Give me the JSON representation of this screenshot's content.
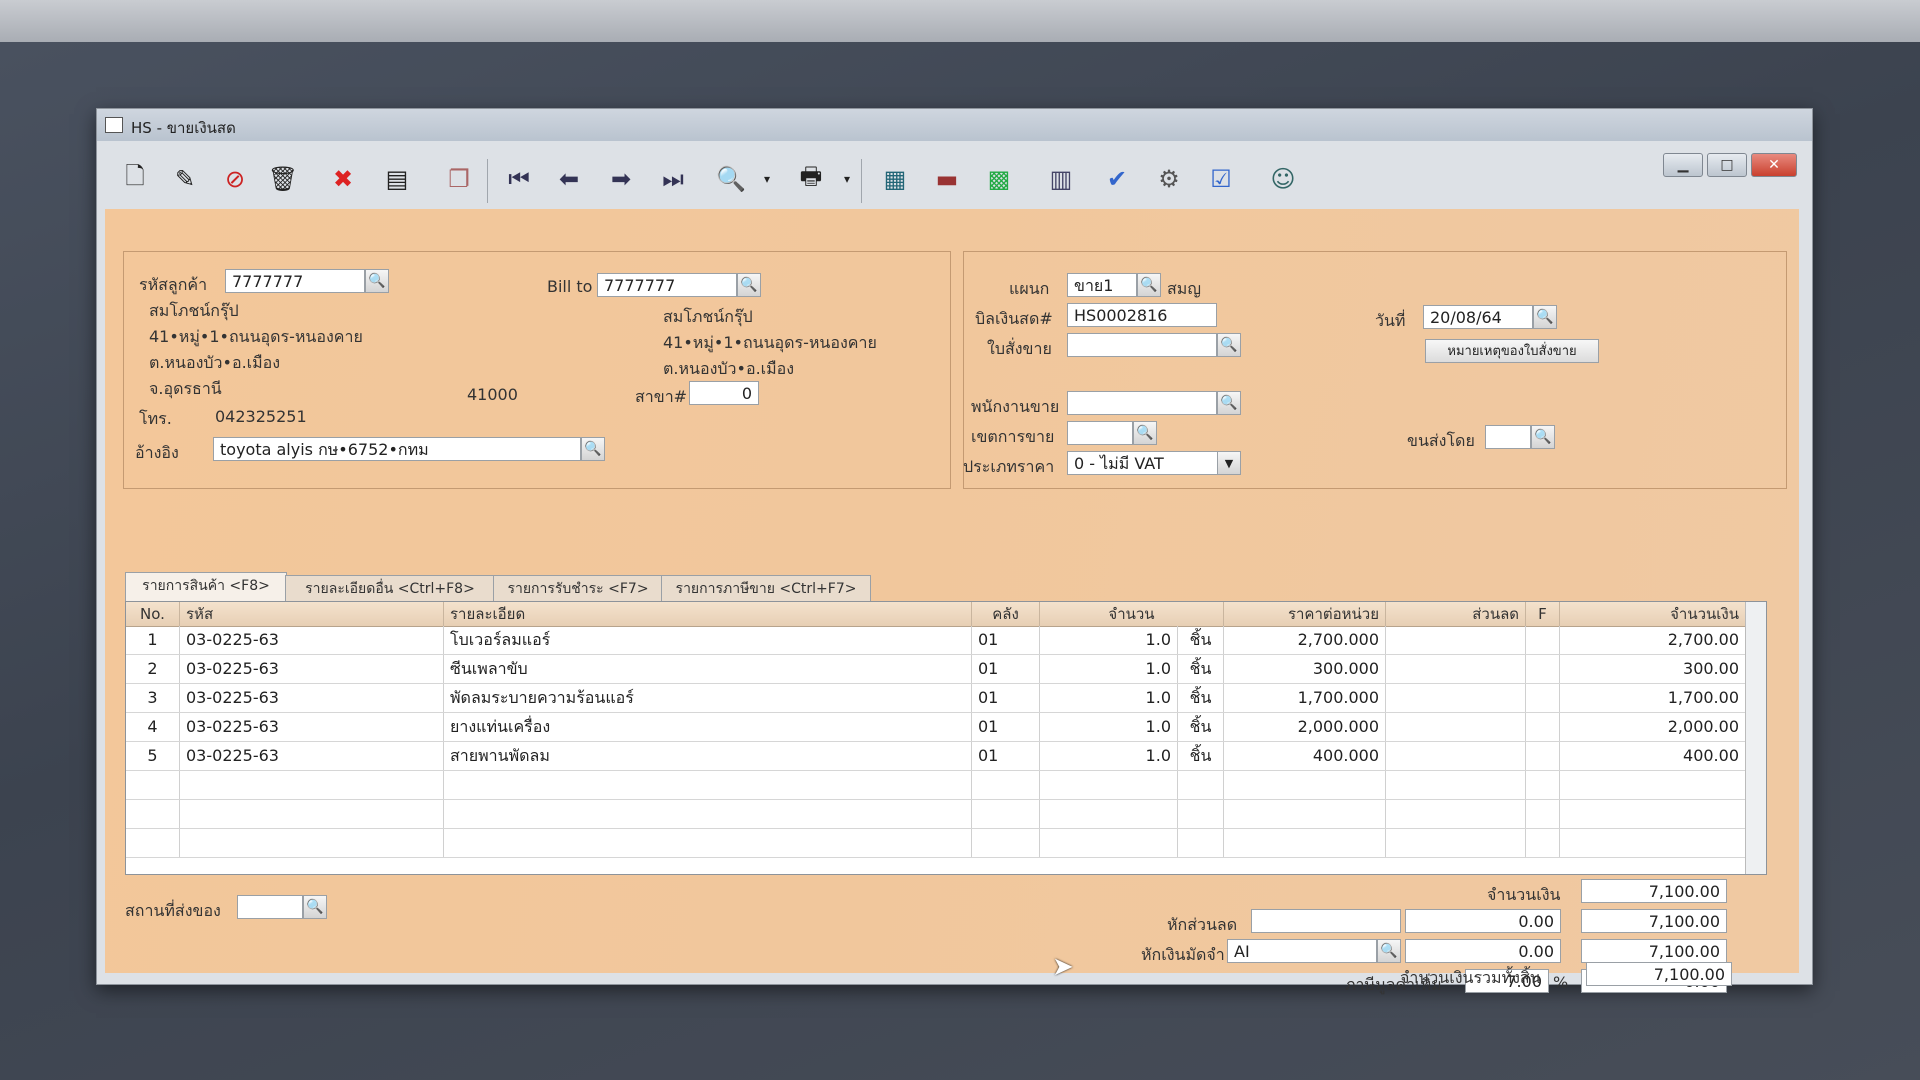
{
  "window": {
    "title": "HS - ขายเงินสด"
  },
  "customer": {
    "code_label": "รหัสลูกค้า",
    "code": "7777777",
    "name": "สมโภชน์กรุ๊ป",
    "address1": "41•หมู่•1•ถนนอุดร-หนองคาย",
    "address2": "ต.หนองบัว•อ.เมือง",
    "address3": "จ.อุดรธานี",
    "zip": "41000",
    "phone_label": "โทร.",
    "phone": "042325251",
    "ref_label": "อ้างอิง",
    "ref": "toyota alyis กษ•6752•กทม"
  },
  "billto": {
    "label": "Bill to",
    "code": "7777777",
    "name": "สมโภชน์กรุ๊ป",
    "address1": "41•หมู่•1•ถนนอุดร-หนองคาย",
    "address2": "ต.หนองบัว•อ.เมือง",
    "branch_label": "สาขา#",
    "branch": "0"
  },
  "doc": {
    "dept_label": "แผนก",
    "dept": "ขาย1",
    "dept_name": "สมญ",
    "bill_label": "บิลเงินสด#",
    "bill": "HS0002816",
    "order_label": "ใบสั่งขาย",
    "order": "",
    "date_label": "วันที่",
    "date": "20/08/64",
    "order_note_button": "หมายเหตุของใบสั่งขาย",
    "sales_label": "พนักงานขาย",
    "sales": "",
    "area_label": "เขตการขาย",
    "area": "",
    "ship_label": "ขนส่งโดย",
    "ship": "",
    "price_type_label": "ประเภทราคา",
    "price_type": "0 - ไม่มี VAT"
  },
  "tabs": [
    {
      "label": "รายการสินค้า <F8>"
    },
    {
      "label": "รายละเอียดอื่น <Ctrl+F8>"
    },
    {
      "label": "รายการรับชำระ <F7>"
    },
    {
      "label": "รายการภาษีขาย <Ctrl+F7>"
    }
  ],
  "table": {
    "headers": [
      "No.",
      "รหัส",
      "รายละเอียด",
      "คลัง",
      "จำนวน",
      "ราคาต่อหน่วย",
      "ส่วนลด",
      "F",
      "จำนวนเงิน"
    ],
    "rows": [
      {
        "no": "1",
        "code": "03-0225-63",
        "desc": "โบเวอร์ลมแอร์",
        "wh": "01",
        "qty": "1.0",
        "unit": "ชิ้น",
        "price": "2,700.000",
        "disc": "",
        "f": "",
        "amount": "2,700.00"
      },
      {
        "no": "2",
        "code": "03-0225-63",
        "desc": "ซีนเพลาขับ",
        "wh": "01",
        "qty": "1.0",
        "unit": "ชิ้น",
        "price": "300.000",
        "disc": "",
        "f": "",
        "amount": "300.00"
      },
      {
        "no": "3",
        "code": "03-0225-63",
        "desc": "พัดลมระบายความร้อนแอร์",
        "wh": "01",
        "qty": "1.0",
        "unit": "ชิ้น",
        "price": "1,700.000",
        "disc": "",
        "f": "",
        "amount": "1,700.00"
      },
      {
        "no": "4",
        "code": "03-0225-63",
        "desc": "ยางแท่นเครื่อง",
        "wh": "01",
        "qty": "1.0",
        "unit": "ชิ้น",
        "price": "2,000.000",
        "disc": "",
        "f": "",
        "amount": "2,000.00"
      },
      {
        "no": "5",
        "code": "03-0225-63",
        "desc": "สายพานพัดลม",
        "wh": "01",
        "qty": "1.0",
        "unit": "ชิ้น",
        "price": "400.000",
        "disc": "",
        "f": "",
        "amount": "400.00"
      }
    ]
  },
  "footer": {
    "delivery_label": "สถานที่ส่งของ",
    "delivery": "",
    "amount_label": "จำนวนเงิน",
    "amount": "7,100.00",
    "discount_label": "หักส่วนลด",
    "discount_text": "",
    "discount_value": "0.00",
    "discount_total": "7,100.00",
    "deposit_label": "หักเงินมัดจำ",
    "deposit_code": "AI",
    "deposit_value": "0.00",
    "deposit_total": "7,100.00",
    "vat_label": "ภาษีมูลค่าเพิ่ม",
    "vat_rate": "7.00",
    "vat_pct": "%",
    "vat_value": "0.00",
    "grand_label": "จำนวนเงินรวมทั้งสิ้น",
    "grand_total": "7,100.00"
  }
}
